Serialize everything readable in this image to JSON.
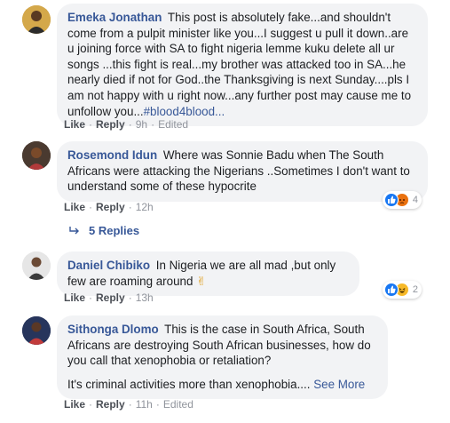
{
  "comments": [
    {
      "author": "Emeka Jonathan",
      "text": "This post is absolutely fake...and shouldn't come from a pulpit minister like you...I suggest u pull it down..are u joining force with SA to fight nigeria lemme kuku delete all ur songs ...this fight is real...my brother was attacked too in SA...he nearly died if not for God..the Thanksgiving is next Sunday....pls I am not happy with u right now...any further post may cause me to unfollow you...",
      "hashtag": "#blood4blood...",
      "like": "Like",
      "reply": "Reply",
      "time": "9h",
      "edited": "Edited"
    },
    {
      "author": "Rosemond Idun",
      "text": "Where was Sonnie Badu when The South Africans were attacking the Nigerians ..Sometimes I don't want to understand some of these hypocrite",
      "like": "Like",
      "reply": "Reply",
      "time": "12h",
      "reaction_count": "4",
      "reaction_icons": [
        "like-icon",
        "angry-icon"
      ]
    },
    {
      "author": "Daniel Chibiko",
      "text": "In Nigeria we are all mad ,but only few are roaming around",
      "emoji": "✌",
      "like": "Like",
      "reply": "Reply",
      "time": "13h",
      "reaction_count": "2",
      "reaction_icons": [
        "like-icon",
        "haha-icon"
      ]
    },
    {
      "author": "Sithonga Dlomo",
      "text": "This is the case in South Africa, South Africans are destroying South African businesses, how do you call that xenophobia or retaliation?",
      "text2": "It's criminal activities more than xenophobia....",
      "see_more": "See More",
      "like": "Like",
      "reply": "Reply",
      "time": "11h",
      "edited": "Edited"
    }
  ],
  "replies_link": "5 Replies",
  "colors": {
    "link_blue": "#385898",
    "bubble_bg": "#f2f3f5",
    "meta_grey": "#90949c",
    "like_blue": "#1877f2",
    "angry_orange": "#e9710f",
    "haha_yellow": "#f7b928"
  }
}
